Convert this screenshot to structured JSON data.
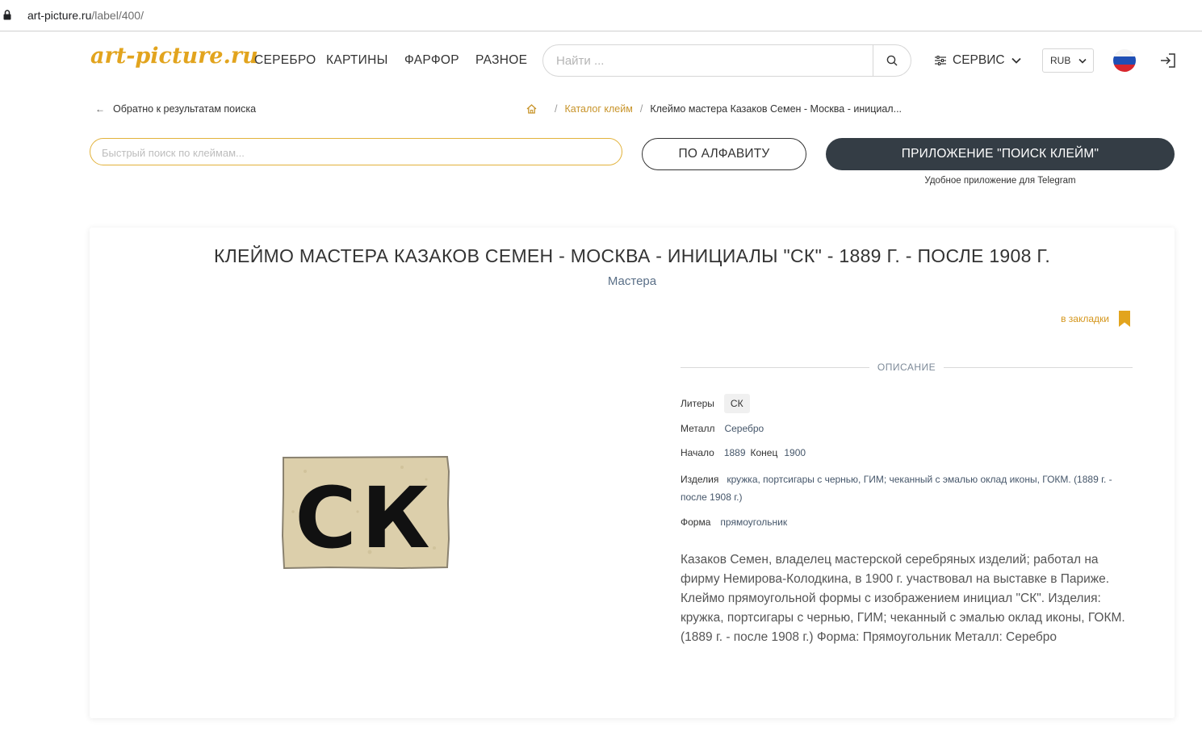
{
  "browser": {
    "url_host": "art-picture.ru",
    "url_path": "/label/400/"
  },
  "header": {
    "logo": "art-picture.ru",
    "nav": [
      "СЕРЕБРО",
      "КАРТИНЫ",
      "ФАРФОР",
      "РАЗНОЕ"
    ],
    "search_placeholder": "Найти ...",
    "service_label": "СЕРВИС",
    "currency": "RUB"
  },
  "breadcrumbs": {
    "back_label": "Обратно к результатам поиска",
    "catalog": "Каталог клейм",
    "current": "Клеймо мастера Казаков Семен - Москва - инициал..."
  },
  "toolbar": {
    "quick_search_placeholder": "Быстрый поиск по клеймам...",
    "alphabet_button": "ПО АЛФАВИТУ",
    "app_button": "ПРИЛОЖЕНИЕ \"ПОИСК КЛЕЙМ\"",
    "app_subtitle": "Удобное приложение для Telegram"
  },
  "card": {
    "title": "КЛЕЙМО МАСТЕРА КАЗАКОВ СЕМЕН - МОСКВА - ИНИЦИАЛЫ \"СК\" - 1889 Г. - ПОСЛЕ 1908 Г.",
    "category": "Мастера",
    "bookmark_label": "в закладки",
    "mark_letters": "СК",
    "description_heading": "ОПИСАНИЕ",
    "fields": {
      "letters_label": "Литеры",
      "letters_value": "СК",
      "metal_label": "Металл",
      "metal_value": "Серебро",
      "start_label": "Начало",
      "start_value": "1889",
      "end_label": "Конец",
      "end_value": "1900",
      "items_label": "Изделия",
      "items_value": "кружка, портсигары с чернью, ГИМ; чеканный с эмалью оклад иконы, ГОКМ. (1889 г. - после 1908 г.)",
      "shape_label": "Форма",
      "shape_value": "прямоугольник"
    },
    "text": "Казаков Семен, владелец мастерской серебряных изделий; работал на фирму Немирова-Колодкина, в 1900 г. участвовал на выставке в Париже. Клеймо прямоугольной формы с изображением инициал \"СК\". Изделия: кружка, портсигары с чернью, ГИМ; чеканный с эмалью оклад иконы, ГОКМ. (1889 г. - после 1908 г.) Форма: Прямоугольник Металл: Серебро"
  },
  "colors": {
    "accent": "#e2a41e",
    "dark_button": "#343d45",
    "link_blue": "#5a6f87"
  }
}
